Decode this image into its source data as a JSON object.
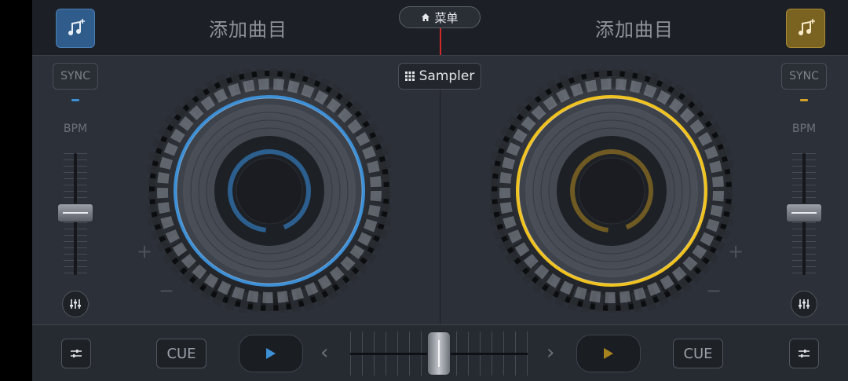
{
  "top": {
    "left_track_title": "添加曲目",
    "right_track_title": "添加曲目",
    "menu_label": "菜单",
    "sampler_label": "Sampler"
  },
  "deck_left": {
    "sync_label": "SYNC",
    "bpm_label": "BPM",
    "accent": "#3d8fd6",
    "plus": "+",
    "minus": "−",
    "cue_label": "CUE"
  },
  "deck_right": {
    "sync_label": "SYNC",
    "bpm_label": "BPM",
    "accent": "#d6a22a",
    "plus": "+",
    "minus": "−",
    "cue_label": "CUE"
  },
  "controls": {
    "prev_arrow": "‹",
    "next_arrow": "›",
    "crossfader_position": 0.5
  },
  "icons": {
    "add_track": "music-note-plus-icon",
    "home": "home-icon",
    "sampler": "grid-icon",
    "mixer": "equalizer-icon",
    "settings": "sliders-icon",
    "play": "play-icon"
  }
}
